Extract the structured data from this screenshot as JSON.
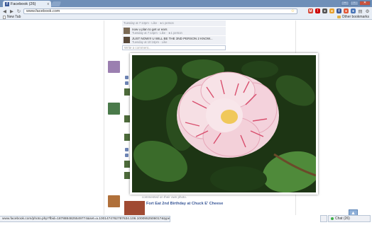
{
  "browser": {
    "tab_title": "Facebook (26)",
    "tab_close": "x",
    "url": "www.facebook.com",
    "bookmarks": [
      {
        "label": "New Tab"
      }
    ],
    "other_bookmarks": "Other bookmarks",
    "status_url": "www.facebook.com/photo.php?fbid=1878884825549774&set=a.1001474762787634.106.1000952506017&type=1&theater",
    "icons": [
      "back-icon",
      "forward-icon",
      "reload-icon",
      "star-icon",
      "gmail-icon",
      "extension-icon"
    ]
  },
  "comments": [
    {
      "text": "",
      "meta": "Tuesday at 7:13pm · Like · ★1 person"
    },
    {
      "text": "now u plan to get ur ears",
      "meta": "Tuesday at 7:14pm · Like · ★1 person"
    },
    {
      "text": "JUST NOW!!! U WILL BE THE 3ND PERSON 2 KNOW...",
      "meta": "Tuesday at 10:16pm · Like"
    }
  ],
  "write_comment_placeholder": "Write a comment...",
  "feed": {
    "shared_text": "commented on their own photo.",
    "story_title": "Fort Eat 2nd Birthday at Chuck E' Cheese"
  },
  "chat": {
    "label": "Chat (26)"
  },
  "colors": {
    "facebook_blue": "#3b5998",
    "chrome_frame": "#6f8fb8"
  }
}
